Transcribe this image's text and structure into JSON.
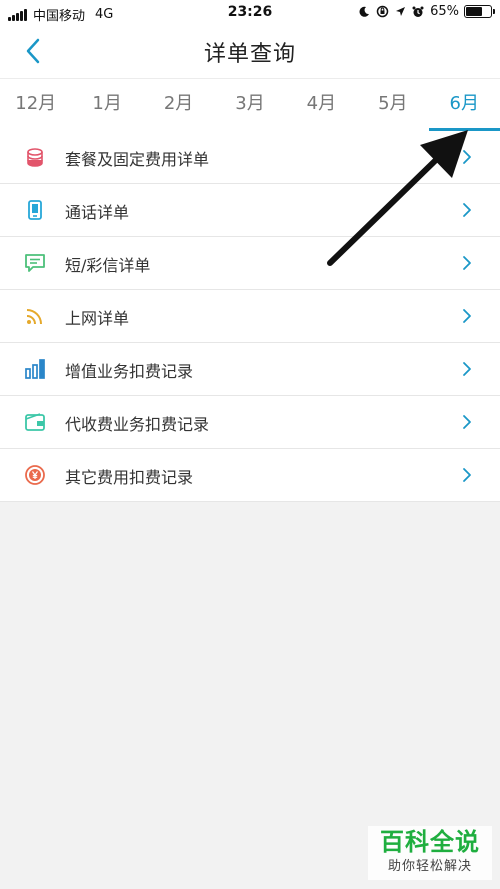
{
  "status_bar": {
    "carrier": "中国移动",
    "network": "4G",
    "time": "23:26",
    "battery": "65%",
    "battery_level": 0.65,
    "icons": [
      "moon-icon",
      "rotation-lock-icon",
      "location-icon",
      "alarm-icon"
    ]
  },
  "nav": {
    "title": "详单查询",
    "back_icon": "chevron-left-icon"
  },
  "tabs": [
    {
      "label": "12月",
      "active": false
    },
    {
      "label": "1月",
      "active": false
    },
    {
      "label": "2月",
      "active": false
    },
    {
      "label": "3月",
      "active": false
    },
    {
      "label": "4月",
      "active": false
    },
    {
      "label": "5月",
      "active": false
    },
    {
      "label": "6月",
      "active": true
    }
  ],
  "list": [
    {
      "label": "套餐及固定费用详单",
      "icon": "coins-icon",
      "color": "#e2556b"
    },
    {
      "label": "通话详单",
      "icon": "phone-icon",
      "color": "#27a7d8"
    },
    {
      "label": "短/彩信详单",
      "icon": "message-icon",
      "color": "#4cc07a"
    },
    {
      "label": "上网详单",
      "icon": "wifi-icon",
      "color": "#e5a92c"
    },
    {
      "label": "增值业务扣费记录",
      "icon": "bar-chart-icon",
      "color": "#2a86c9"
    },
    {
      "label": "代收费业务扣费记录",
      "icon": "wallet-icon",
      "color": "#3cc7a8"
    },
    {
      "label": "其它费用扣费记录",
      "icon": "yen-coin-icon",
      "color": "#ea6a4c"
    }
  ],
  "colors": {
    "accent": "#1a97c7",
    "background": "#f2f2f2"
  },
  "watermark": {
    "main": "百科全说",
    "sub": "助你轻松解决"
  }
}
